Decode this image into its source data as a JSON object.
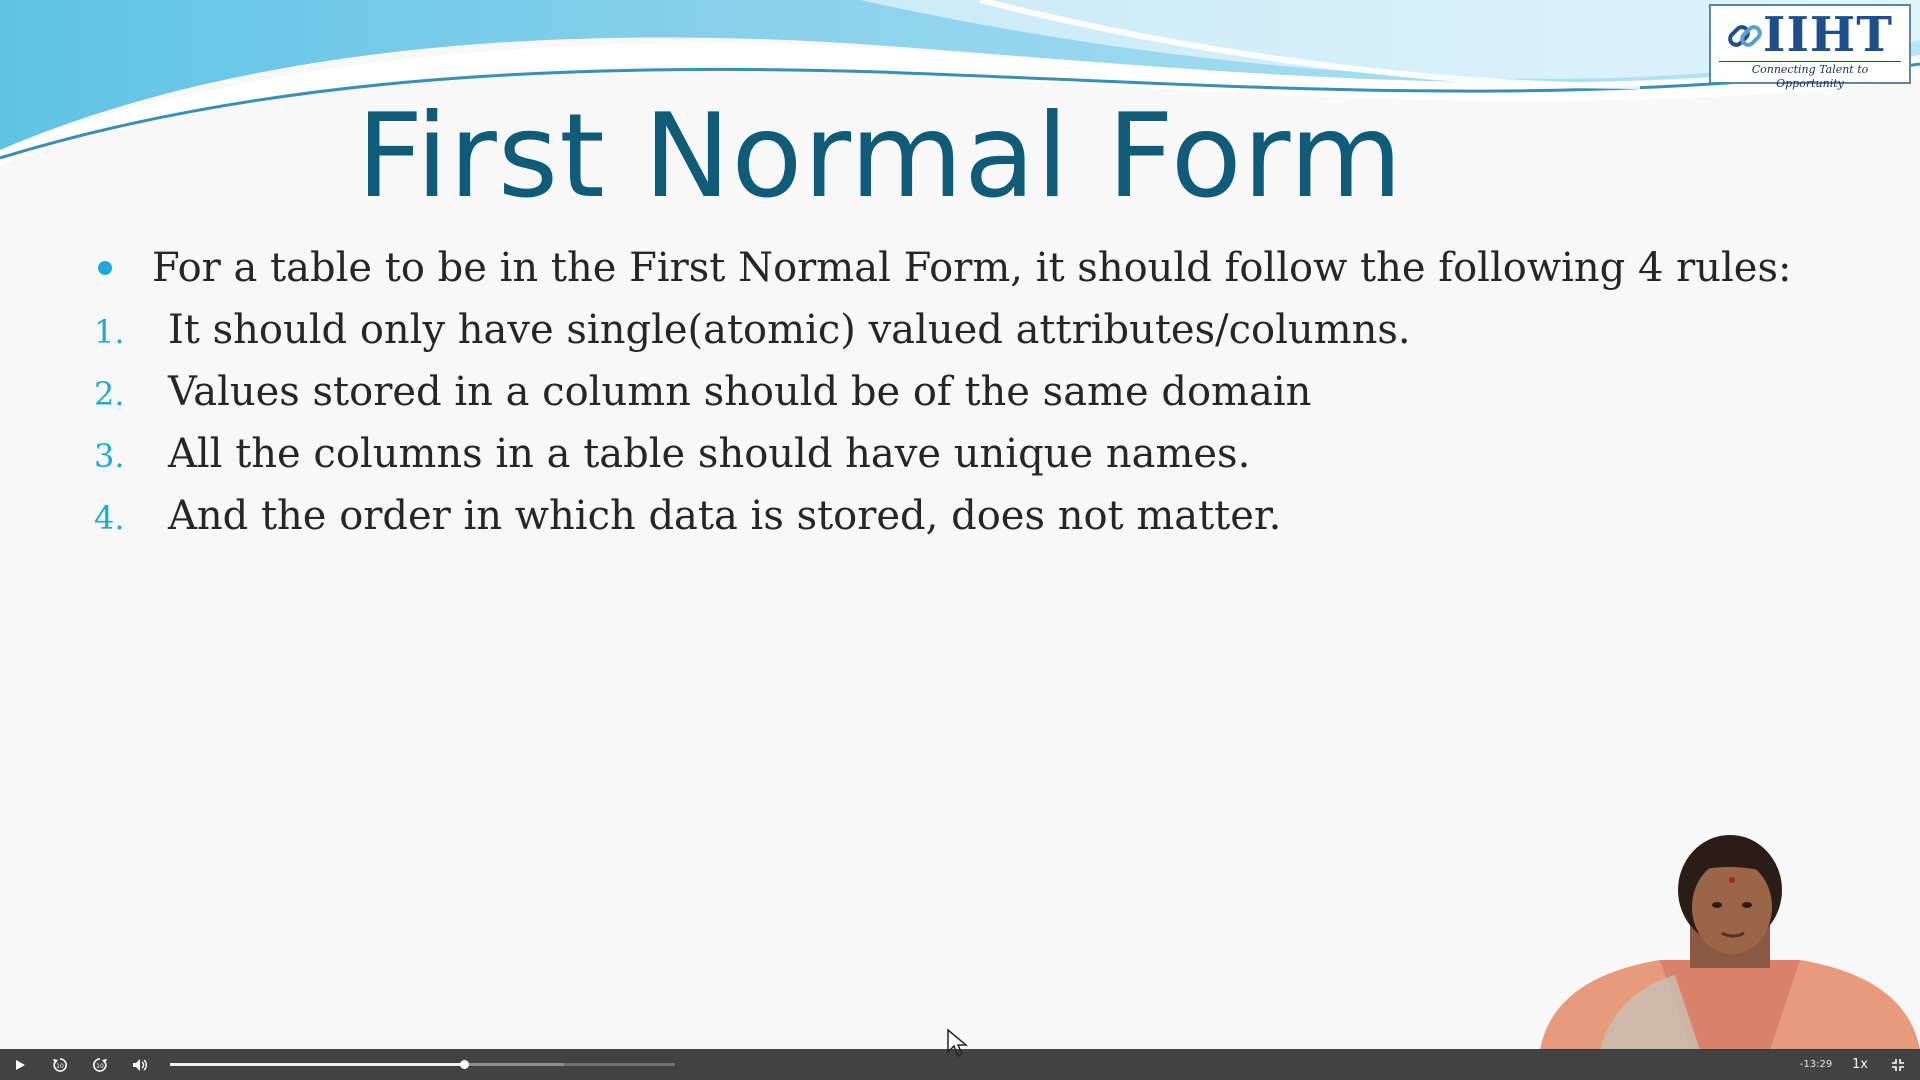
{
  "slide": {
    "title": "First Normal Form",
    "bullet": "For a table to be in the First Normal Form, it should follow the following 4 rules:",
    "rules": [
      {
        "num": "1.",
        "text": "It should only have single(atomic) valued attributes/columns."
      },
      {
        "num": "2.",
        "text": "Values stored in a column should be of the same domain"
      },
      {
        "num": "3.",
        "text": "All the columns in a table should have unique names."
      },
      {
        "num": "4.",
        "text": "And the order in which data is stored, does not matter."
      }
    ]
  },
  "logo": {
    "name": "IIHT",
    "tagline": "Connecting Talent to Opportunity"
  },
  "player": {
    "time_remaining": "-13:29",
    "playback_speed": "1x",
    "progress": 0.583,
    "buffered": 0.78,
    "icons": {
      "play": "play-icon",
      "rewind": "rewind-10-icon",
      "forward": "forward-10-icon",
      "volume": "volume-icon",
      "fullscreen": "exit-fullscreen-icon"
    }
  },
  "colors": {
    "title": "#0f5b78",
    "accent": "#1fa9d6",
    "body_text": "#262626",
    "logo": "#1f4e8c",
    "control_bar": "#282828"
  }
}
